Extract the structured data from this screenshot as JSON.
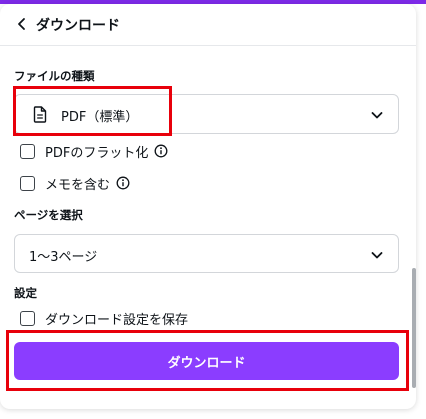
{
  "colors": {
    "accent": "#8b3dff",
    "highlight_border": "#e8000b",
    "text": "#0e1318"
  },
  "header": {
    "title": "ダウンロード",
    "back_icon": "chevron-left-icon"
  },
  "file_type": {
    "label": "ファイルの種類",
    "selected": "PDF（標準）",
    "icon": "document-icon"
  },
  "options": [
    {
      "label": "PDFのフラット化",
      "checked": false,
      "info": true
    },
    {
      "label": "メモを含む",
      "checked": false,
      "info": true
    }
  ],
  "pages": {
    "label": "ページを選択",
    "selected": "1〜3ページ"
  },
  "settings": {
    "label": "設定",
    "save_label": "ダウンロード設定を保存",
    "checked": false
  },
  "download_button": {
    "label": "ダウンロード"
  }
}
